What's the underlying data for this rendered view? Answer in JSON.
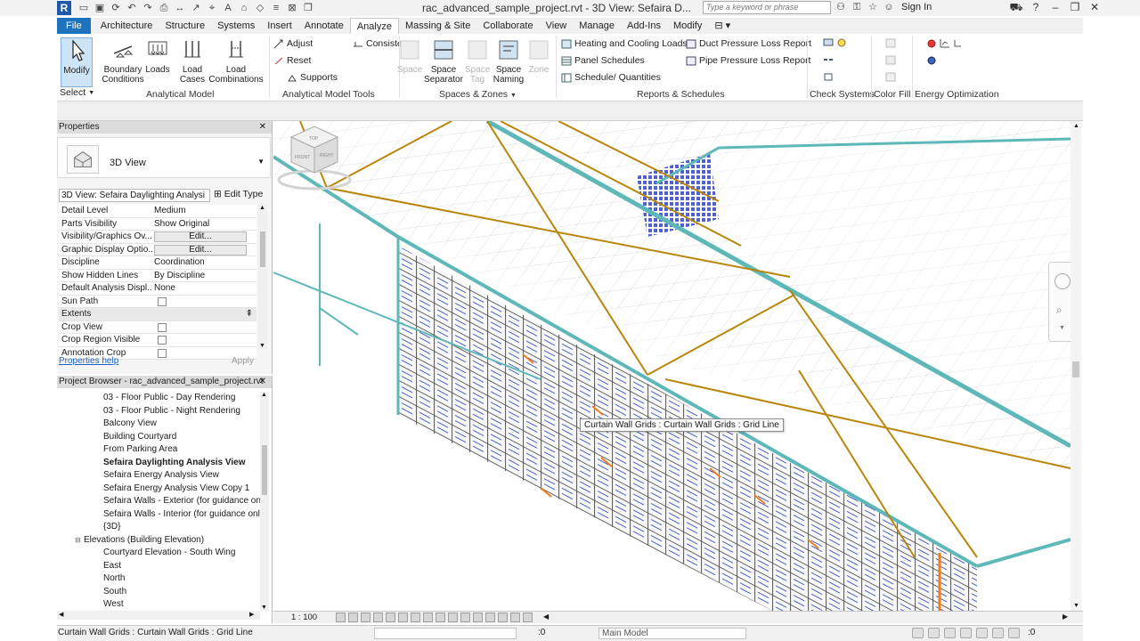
{
  "title_bar": {
    "logo": "R",
    "title": "rac_advanced_sample_project.rvt - 3D View: Sefaira D...",
    "search_placeholder": "Type a keyword or phrase",
    "sign_in": "Sign In"
  },
  "tabs": [
    "File",
    "Architecture",
    "Structure",
    "Systems",
    "Insert",
    "Annotate",
    "Analyze",
    "Massing & Site",
    "Collaborate",
    "View",
    "Manage",
    "Add-Ins",
    "Modify"
  ],
  "active_tab": "Analyze",
  "ribbon": {
    "modify": "Modify",
    "select": "Select",
    "boundary_conditions": "Boundary Conditions",
    "loads": "Loads",
    "load_cases": "Load Cases",
    "load_combinations": "Load Combinations",
    "analytical_model": "Analytical Model",
    "adjust": "Adjust",
    "reset": "Reset",
    "supports": "Supports",
    "consistency": "Consistency",
    "analytical_model_tools": "Analytical Model Tools",
    "space": "Space",
    "space_separator": "Space Separator",
    "space_tag": "Space Tag",
    "space_naming": "Space Naming",
    "zone": "Zone",
    "spaces_zones": "Spaces & Zones",
    "heating_cooling": "Heating and Cooling Loads",
    "panel_schedules": "Panel Schedules",
    "schedule_quantities": "Schedule/ Quantities",
    "duct_pressure": "Duct Pressure Loss Report",
    "pipe_pressure": "Pipe Pressure Loss Report",
    "reports_schedules": "Reports & Schedules",
    "check_systems": "Check Systems",
    "color_fill": "Color Fill",
    "energy_optimization": "Energy Optimization"
  },
  "properties": {
    "header": "Properties",
    "type_name": "3D View",
    "instance_selector": "3D View: Sefaira Daylighting Analysi",
    "edit_type": "Edit Type",
    "rows": [
      {
        "label": "Detail Level",
        "value": "Medium"
      },
      {
        "label": "Parts Visibility",
        "value": "Show Original"
      },
      {
        "label": "Visibility/Graphics Ov...",
        "value": "Edit..."
      },
      {
        "label": "Graphic Display Optio...",
        "value": "Edit..."
      },
      {
        "label": "Discipline",
        "value": "Coordination"
      },
      {
        "label": "Show Hidden Lines",
        "value": "By Discipline"
      },
      {
        "label": "Default Analysis Displ...",
        "value": "None"
      },
      {
        "label": "Sun Path",
        "value": ""
      }
    ],
    "group": "Extents",
    "extent_rows": [
      {
        "label": "Crop View",
        "value": ""
      },
      {
        "label": "Crop Region Visible",
        "value": ""
      },
      {
        "label": "Annotation Crop",
        "value": ""
      }
    ],
    "help_link": "Properties help",
    "apply": "Apply"
  },
  "project_browser": {
    "header": "Project Browser - rac_advanced_sample_project.rvt",
    "items": [
      {
        "label": "03 - Floor Public - Day Rendering",
        "level": 3
      },
      {
        "label": "03 - Floor Public - Night Rendering",
        "level": 3
      },
      {
        "label": "Balcony View",
        "level": 3
      },
      {
        "label": "Building Courtyard",
        "level": 3
      },
      {
        "label": "From Parking Area",
        "level": 3
      },
      {
        "label": "Sefaira Daylighting Analysis View",
        "level": 3,
        "selected": true
      },
      {
        "label": "Sefaira Energy Analysis View",
        "level": 3
      },
      {
        "label": "Sefaira Energy Analysis View Copy 1",
        "level": 3
      },
      {
        "label": "Sefaira Walls - Exterior (for guidance only",
        "level": 3
      },
      {
        "label": "Sefaira Walls - Interior (for guidance only",
        "level": 3
      },
      {
        "label": "{3D}",
        "level": 3
      },
      {
        "label": "Elevations (Building Elevation)",
        "level": 2,
        "expander": "⊟"
      },
      {
        "label": "Courtyard Elevation - South Wing",
        "level": 3
      },
      {
        "label": "East",
        "level": 3
      },
      {
        "label": "North",
        "level": 3
      },
      {
        "label": "South",
        "level": 3
      },
      {
        "label": "West",
        "level": 3
      }
    ]
  },
  "viewport": {
    "tooltip": "Curtain Wall Grids : Curtain Wall Grids : Grid Line",
    "cube_top": "TOP",
    "cube_front": "FRONT",
    "cube_right": "RIGHT"
  },
  "view_control": {
    "scale": "1 : 100"
  },
  "status_bar": {
    "text": "Curtain Wall Grids : Curtain Wall Grids : Grid Line",
    "zero_left": ":0",
    "model": "Main Model",
    "zero_right": ":0"
  },
  "colors": {
    "accent": "#1e73be",
    "beam": "#b8860b",
    "slab_edge": "#5fb8b8",
    "glass": "#3a4fc8"
  }
}
